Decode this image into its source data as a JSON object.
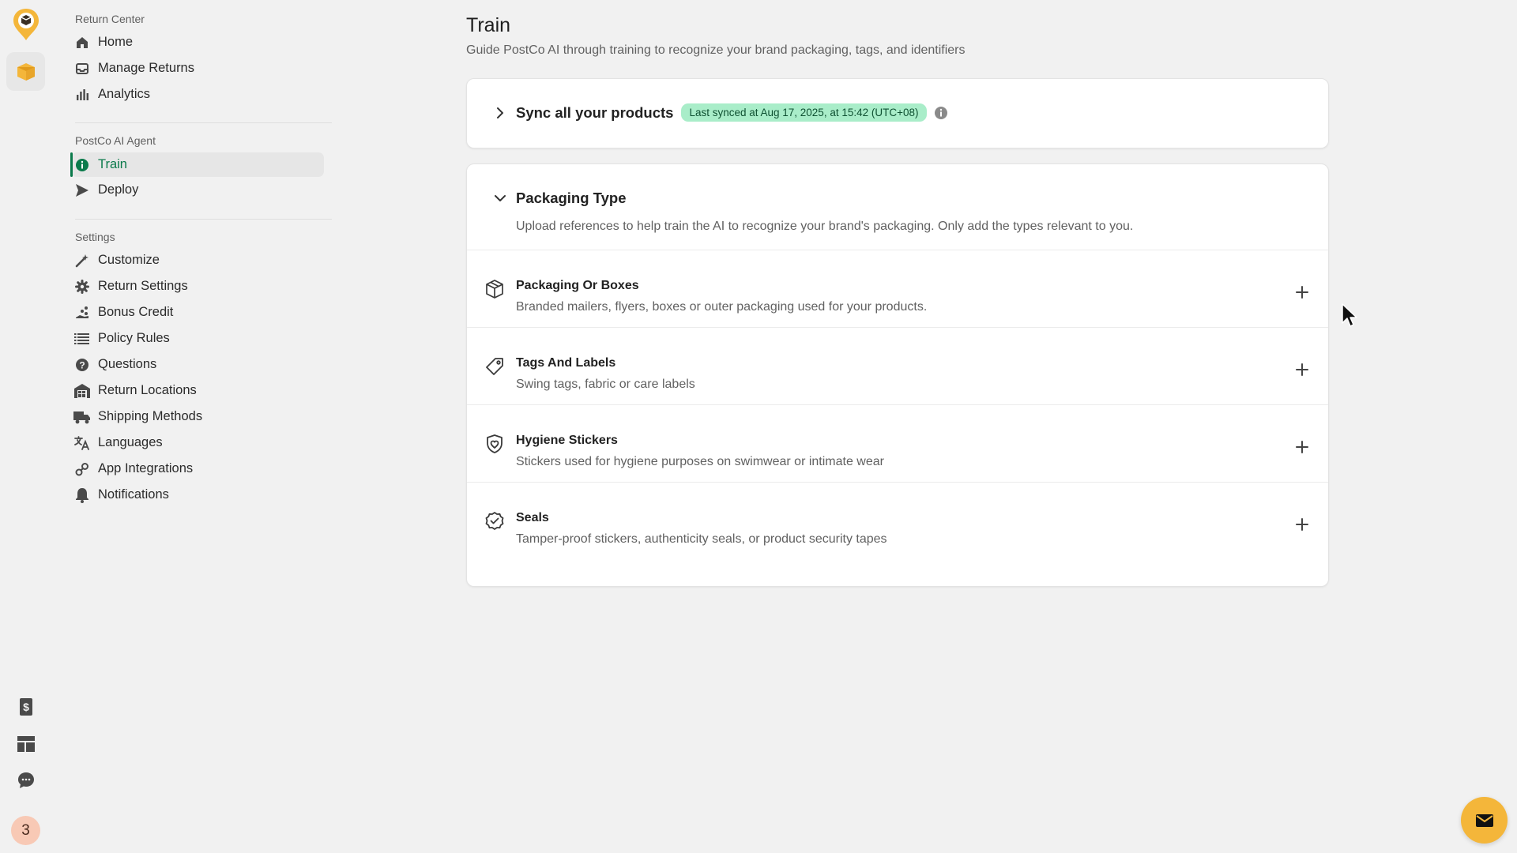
{
  "rail": {
    "badge_count": "3",
    "icons": [
      "postco-logo-icon",
      "box-icon",
      "dollar-receipt-icon",
      "layout-icon",
      "chat-bubble-icon"
    ]
  },
  "sidebar": {
    "sections": [
      {
        "title": "Return Center",
        "items": [
          {
            "label": "Home",
            "icon": "home-icon"
          },
          {
            "label": "Manage Returns",
            "icon": "inbox-icon"
          },
          {
            "label": "Analytics",
            "icon": "bar-chart-icon"
          }
        ]
      },
      {
        "title": "PostCo AI Agent",
        "items": [
          {
            "label": "Train",
            "icon": "info-circle-icon",
            "active": true
          },
          {
            "label": "Deploy",
            "icon": "send-icon"
          }
        ]
      },
      {
        "title": "Settings",
        "items": [
          {
            "label": "Customize",
            "icon": "magic-wand-icon"
          },
          {
            "label": "Return Settings",
            "icon": "gear-icon"
          },
          {
            "label": "Bonus Credit",
            "icon": "coins-icon"
          },
          {
            "label": "Policy Rules",
            "icon": "list-icon"
          },
          {
            "label": "Questions",
            "icon": "question-circle-icon"
          },
          {
            "label": "Return Locations",
            "icon": "warehouse-icon"
          },
          {
            "label": "Shipping Methods",
            "icon": "truck-icon"
          },
          {
            "label": "Languages",
            "icon": "translate-icon"
          },
          {
            "label": "App Integrations",
            "icon": "link-icon"
          },
          {
            "label": "Notifications",
            "icon": "bell-icon"
          }
        ]
      }
    ]
  },
  "main": {
    "title": "Train",
    "subtitle": "Guide PostCo AI through training to recognize your brand packaging, tags, and identifiers",
    "sync": {
      "title": "Sync all your products",
      "badge": "Last synced at Aug 17, 2025, at 15:42 (UTC+08)"
    },
    "packaging": {
      "title": "Packaging Type",
      "description": "Upload references to help train the AI to recognize your brand's packaging. Only add the types relevant to you.",
      "types": [
        {
          "title": "Packaging Or Boxes",
          "description": "Branded mailers, flyers, boxes or outer packaging used for your products.",
          "icon": "box-icon"
        },
        {
          "title": "Tags And Labels",
          "description": "Swing tags, fabric or care labels",
          "icon": "tag-icon"
        },
        {
          "title": "Hygiene Stickers",
          "description": "Stickers used for hygiene purposes on swimwear or intimate wear",
          "icon": "shield-icon"
        },
        {
          "title": "Seals",
          "description": "Tamper-proof stickers, authenticity seals, or product security tapes",
          "icon": "seal-check-icon"
        }
      ]
    }
  },
  "colors": {
    "accent_green": "#0b7a4b",
    "badge_bg": "#a9edc9",
    "fab": "#f4b63a",
    "avatar_badge": "#f8c9b5"
  }
}
